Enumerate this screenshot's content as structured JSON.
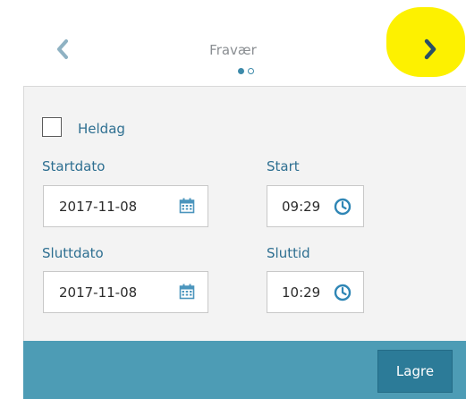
{
  "header": {
    "title": "Fravær",
    "back_icon": "chevron-left-icon",
    "next_icon": "chevron-right-icon",
    "pager": {
      "count": 2,
      "active_index": 0
    },
    "colors": {
      "accent": "#3d8aaa",
      "highlight": "#fdf100",
      "chevron": "#8fb2c3",
      "chevron_next": "#2a4f66"
    }
  },
  "form": {
    "heldag": {
      "label": "Heldag",
      "checked": false
    },
    "startdato": {
      "label": "Startdato",
      "value": "2017-11-08",
      "icon": "calendar-icon"
    },
    "start": {
      "label": "Start",
      "value": "09:29",
      "icon": "clock-icon"
    },
    "sluttdato": {
      "label": "Sluttdato",
      "value": "2017-11-08",
      "icon": "calendar-icon"
    },
    "sluttid": {
      "label": "Sluttid",
      "value": "10:29",
      "icon": "clock-icon"
    }
  },
  "footer": {
    "save_label": "Lagre",
    "bar_color": "#4d9cb5",
    "button_color": "#2c7b98"
  }
}
